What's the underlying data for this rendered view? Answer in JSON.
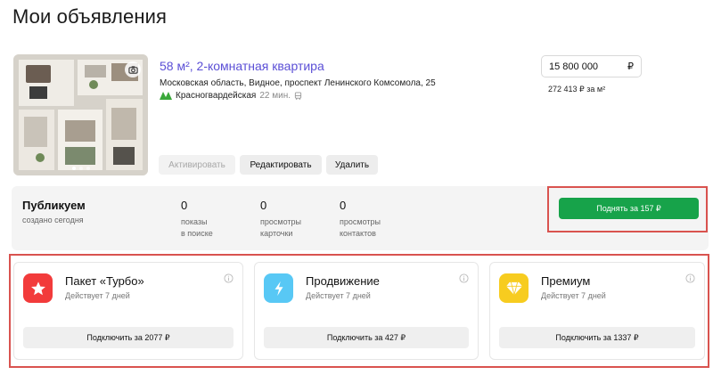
{
  "page": {
    "title": "Мои объявления"
  },
  "listing": {
    "title": "58 м², 2-комнатная квартира",
    "address": "Московская область, Видное, проспект Ленинского Комсомола, 25",
    "metro": {
      "station": "Красногвардейская",
      "time": "22 мин."
    },
    "price": "15 800 000",
    "currency": "₽",
    "price_per_sqm": "272 413 ₽ за м²",
    "actions": {
      "activate": "Активировать",
      "edit": "Редактировать",
      "delete": "Удалить"
    }
  },
  "stats": {
    "status_title": "Публикуем",
    "status_sub": "создано сегодня",
    "items": [
      {
        "value": "0",
        "label_1": "показы",
        "label_2": "в поиске"
      },
      {
        "value": "0",
        "label_1": "просмотры",
        "label_2": "карточки"
      },
      {
        "value": "0",
        "label_1": "просмотры",
        "label_2": "контактов"
      }
    ],
    "raise_label": "Поднять за 157 ₽"
  },
  "services": [
    {
      "title": "Пакет «Турбо»",
      "sub": "Действует 7 дней",
      "button": "Подключить за 2077 ₽",
      "color": "#f23b3b",
      "icon": "star-icon"
    },
    {
      "title": "Продвижение",
      "sub": "Действует 7 дней",
      "button": "Подключить за 427 ₽",
      "color": "#58c8f5",
      "icon": "lightning-icon"
    },
    {
      "title": "Премиум",
      "sub": "Действует 7 дней",
      "button": "Подключить за 1337 ₽",
      "color": "#f7cc1f",
      "icon": "diamond-icon"
    }
  ],
  "colors": {
    "accent_link": "#5b4fd6",
    "raise_button": "#17a34a",
    "highlight": "#d9534f"
  }
}
